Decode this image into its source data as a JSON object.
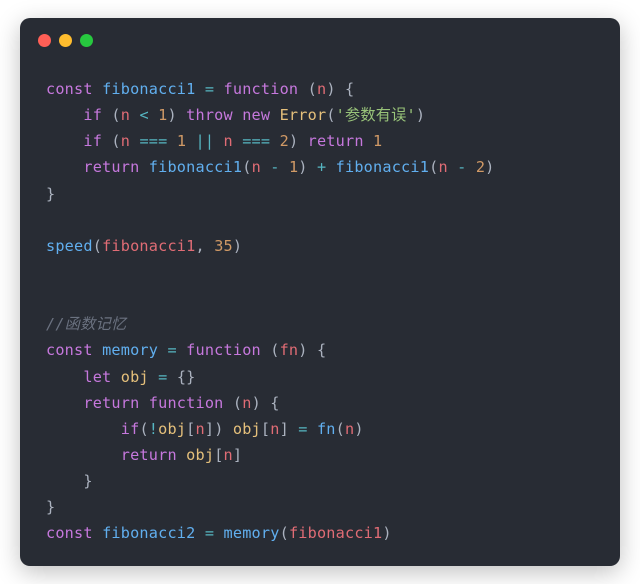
{
  "titlebar": {
    "buttons": [
      "close",
      "minimize",
      "zoom"
    ]
  },
  "tokens": {
    "const": "const",
    "function": "function",
    "if": "if",
    "throw": "throw",
    "new": "new",
    "return": "return",
    "let": "let",
    "Error": "Error",
    "fibonacci1": "fibonacci1",
    "fibonacci2": "fibonacci2",
    "memory": "memory",
    "speed": "speed",
    "obj": "obj",
    "fn": "fn",
    "n": "n",
    "str_err": "'参数有误'",
    "num_1": "1",
    "num_2": "2",
    "num_35": "35",
    "op_assign": "=",
    "op_lt": "<",
    "op_seq": "===",
    "op_or": "||",
    "op_minus": "-",
    "op_plus": "+",
    "op_not": "!",
    "p_lparen": "(",
    "p_rparen": ")",
    "p_lbrace": "{",
    "p_rbrace": "}",
    "p_lbrack": "[",
    "p_rbrack": "]",
    "p_comma": ",",
    "comment": "//函数记忆"
  }
}
